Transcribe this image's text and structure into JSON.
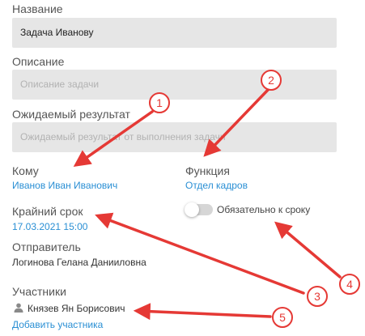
{
  "form": {
    "name_label": "Название",
    "name_value": "Задача Иванову",
    "description_label": "Описание",
    "description_placeholder": "Описание задачи",
    "result_label": "Ожидаемый результат",
    "result_placeholder": "Ожидаемый результат от выполнения задачи",
    "to_label": "Кому",
    "to_value": "Иванов Иван Иванович",
    "function_label": "Функция",
    "function_value": "Отдел кадров",
    "deadline_label": "Крайний срок",
    "deadline_value": "17.03.2021 15:00",
    "strict_deadline_label": "Обязательно к сроку",
    "sender_label": "Отправитель",
    "sender_value": "Логинова Гелана Данииловна",
    "participants_label": "Участники",
    "participant_name": "Князев Ян Борисович",
    "add_participant_label": "Добавить участника"
  },
  "annotations": {
    "color": "#e53935",
    "markers": [
      "1",
      "2",
      "3",
      "4",
      "5"
    ]
  },
  "icons": {
    "participant": "user-icon"
  }
}
